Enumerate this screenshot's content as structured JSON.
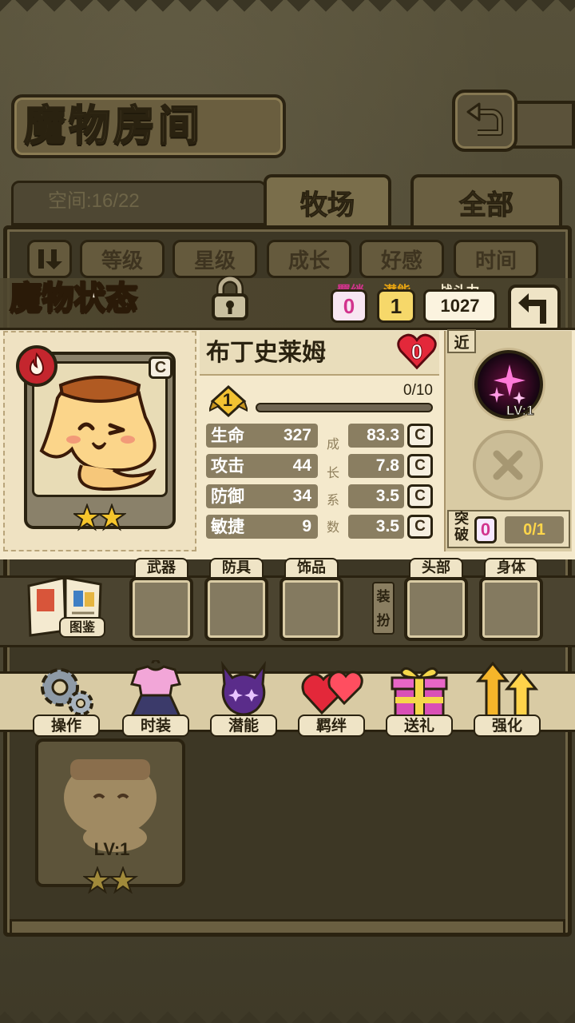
{
  "screen_title": "魔物房间",
  "space_label": "空间:16/22",
  "tabs": [
    {
      "label": "牧场",
      "active": true
    },
    {
      "label": "全部",
      "active": false
    }
  ],
  "filters": [
    "等级",
    "星级",
    "成长",
    "好感",
    "时间"
  ],
  "status": {
    "title": "魔物状态",
    "bond_label": "羁绊",
    "bond_value": "0",
    "potential_label": "潜能",
    "potential_value": "1",
    "power_label": "战斗力",
    "power_value": "1027"
  },
  "monster": {
    "name": "布丁史莱姆",
    "rank": "C",
    "stars": 2,
    "heart_value": "0",
    "level": "1",
    "xp_text": "0/10",
    "xp_fraction": 0.0,
    "stats": [
      {
        "label": "生命",
        "value": "327",
        "growth": "83.3",
        "grade": "C"
      },
      {
        "label": "攻击",
        "value": "44",
        "growth": "7.8",
        "grade": "C"
      },
      {
        "label": "防御",
        "value": "34",
        "growth": "3.5",
        "grade": "C"
      },
      {
        "label": "敏捷",
        "value": "9",
        "growth": "3.5",
        "grade": "C"
      }
    ],
    "growth_chars": [
      "成",
      "长",
      "系",
      "数"
    ]
  },
  "skill": {
    "tag": "近",
    "level": "LV:1"
  },
  "breakthrough": {
    "label": "突破",
    "count": "0",
    "progress": "0/1"
  },
  "equipment": {
    "codex_label": "图鉴",
    "slots": [
      "武器",
      "防具",
      "饰品",
      "头部",
      "身体"
    ],
    "fashion_label": "装扮"
  },
  "actions": [
    "操作",
    "时装",
    "潜能",
    "羁绊",
    "送礼",
    "强化"
  ],
  "underlay_card": {
    "level": "LV:1",
    "stars": 2
  },
  "colors": {
    "accent_pink": "#d2338d",
    "accent_gold": "#f2c232",
    "element_red": "#c4262e",
    "panel_cream": "#f4e9cc"
  }
}
